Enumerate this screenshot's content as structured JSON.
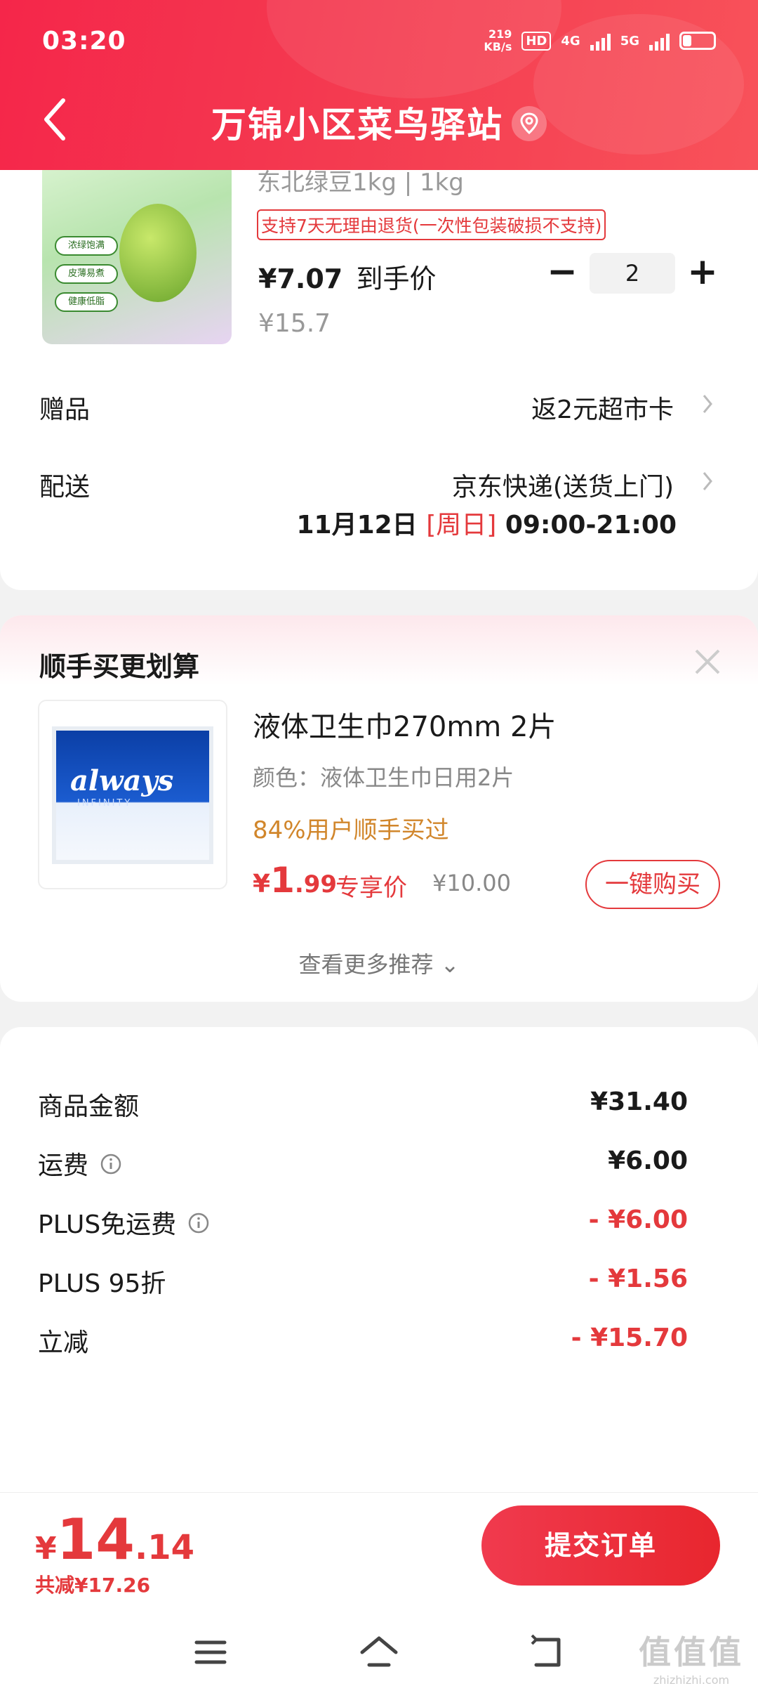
{
  "status_bar": {
    "time": "03:20",
    "net_speed": "219",
    "net_speed_unit": "KB/s",
    "hd_badge": "HD",
    "net_4g": "4G",
    "net_5g": "5G"
  },
  "header": {
    "title": "万锦小区菜鸟驿站",
    "back_icon": "chevron-left-icon",
    "location_icon": "location-pin-icon",
    "background_color": "#f43a50"
  },
  "product": {
    "sku": "东北绿豆1kg | 1kg",
    "return_policy": "支持7天无理由退货(一次性包装破损不支持)",
    "final_price": "¥7.07",
    "final_price_label": "到手价",
    "original_price": "¥15.7",
    "quantity": "2",
    "minus_label": "−",
    "plus_label": "+",
    "image_tags": [
      "浓绿饱满",
      "皮薄易煮",
      "健康低脂"
    ]
  },
  "gift": {
    "label": "赠品",
    "value": "返2元超市卡"
  },
  "delivery": {
    "label": "配送",
    "method": "京东快递(送货上门)",
    "date": "11月12日",
    "day": "[周日]",
    "time_window": "09:00-21:00"
  },
  "upsell": {
    "title": "顺手买更划算",
    "product_name": "液体卫生巾270mm 2片",
    "variant": "颜色：液体卫生巾日用2片",
    "social_proof": "84%用户顺手买过",
    "price_symbol": "¥",
    "price_int": "1",
    "price_dec": ".99",
    "exclusive_label": "专享价",
    "original_price": "¥10.00",
    "buy_button": "一键购买",
    "more_label": "查看更多推荐 ⌄",
    "image_brand": "always",
    "image_sub": "INFINITY"
  },
  "fees": [
    {
      "label": "商品金额",
      "value": "¥31.40",
      "info": false,
      "negative": false
    },
    {
      "label": "运费",
      "value": "¥6.00",
      "info": true,
      "negative": false
    },
    {
      "label": "PLUS免运费",
      "value": "- ¥6.00",
      "info": true,
      "negative": true
    },
    {
      "label": "PLUS 95折",
      "value": "- ¥1.56",
      "info": false,
      "negative": true
    },
    {
      "label": "立减",
      "value": "- ¥15.70",
      "info": false,
      "negative": true
    }
  ],
  "bottom": {
    "currency": "¥",
    "total_int": "14",
    "total_dec": ".14",
    "saved": "共减¥17.26",
    "submit_label": "提交订单",
    "accent_color": "#e4393c"
  },
  "watermark": {
    "text_big": "值值值",
    "text_small": "zhizhizhi.com"
  }
}
